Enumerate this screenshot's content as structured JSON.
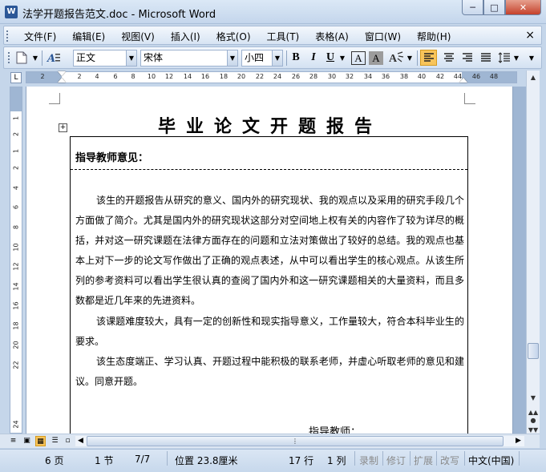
{
  "window": {
    "title": "法学开题报告范文.doc - Microsoft Word",
    "app_icon": "W",
    "controls": [
      "minimize-icon",
      "maximize-icon",
      "close-icon"
    ]
  },
  "menu": {
    "items": [
      "文件(F)",
      "编辑(E)",
      "视图(V)",
      "插入(I)",
      "格式(O)",
      "工具(T)",
      "表格(A)",
      "窗口(W)",
      "帮助(H)"
    ],
    "doc_close": "×"
  },
  "toolbar": {
    "style": "正文",
    "font": "宋体",
    "size": "小四",
    "bold": "B",
    "italic": "I",
    "underline": "U",
    "char_border": "A",
    "char_shading": "A"
  },
  "ruler": {
    "tab_selector": "L",
    "numbers": [
      "2",
      "",
      "2",
      "4",
      "6",
      "8",
      "10",
      "12",
      "14",
      "16",
      "18",
      "20",
      "22",
      "24",
      "26",
      "28",
      "30",
      "32",
      "34",
      "36",
      "38",
      "40",
      "42",
      "44",
      "46",
      "48"
    ],
    "vertical_numbers": [
      "1",
      "2",
      "1",
      "2",
      "4",
      "6",
      "8",
      "10",
      "12",
      "14",
      "16",
      "18",
      "20",
      "22",
      "24"
    ]
  },
  "document": {
    "title": "毕业论文开题报告",
    "box_heading": "指导教师意见：",
    "paragraphs": [
      "该生的开题报告从研究的意义、国内外的研究现状、我的观点以及采用的研究手段几个方面做了简介。尤其是国内外的研究现状这部分对空间地上权有关的内容作了较为详尽的概括，并对这一研究课题在法律方面存在的问题和立法对策做出了较好的总结。我的观点也基本上对下一步的论文写作做出了正确的观点表述，从中可以看出学生的核心观点。从该生所列的参考资料可以看出学生很认真的查阅了国内外和这一研究课题相关的大量资料，而且多数都是近几年来的先进资料。",
      "该课题难度较大，具有一定的创新性和现实指导意义，工作量较大，符合本科毕业生的要求。",
      "该生态度端正、学习认真、开题过程中能积极的联系老师，并虚心听取老师的意见和建议。同意开题。"
    ],
    "signature_label": "指导教师："
  },
  "statusbar": {
    "page": "6 页",
    "section": "1 节",
    "page_of": "7/7",
    "position": "位置 23.8厘米",
    "line": "17 行",
    "column": "1 列",
    "rec": "录制",
    "trk": "修订",
    "ext": "扩展",
    "ovr": "改写",
    "language": "中文(中国)"
  }
}
